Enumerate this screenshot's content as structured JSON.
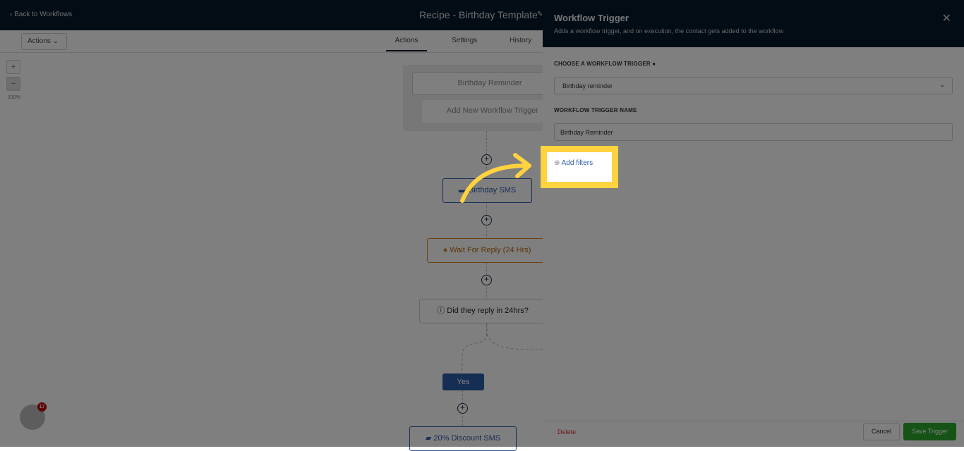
{
  "header": {
    "back_label": "Back to Workflows",
    "title": "Recipe - Birthday Template"
  },
  "toolbar": {
    "actions_label": "Actions",
    "tabs": [
      {
        "label": "Actions",
        "active": true
      },
      {
        "label": "Settings"
      },
      {
        "label": "History"
      }
    ]
  },
  "canvas": {
    "zoom_in": "+",
    "zoom_out": "−",
    "zoom_level": "100%",
    "trigger": "Birthday Reminder",
    "add_trigger": "Add New Workflow Trigger",
    "nodes": {
      "sms": "Birthday SMS",
      "wait": "Wait For Reply (24 Hrs)",
      "condition": "Did they reply in 24hrs?",
      "yes": "Yes",
      "discount": "20% Discount SMS"
    }
  },
  "panel": {
    "title": "Workflow Trigger",
    "subtitle": "Adds a workflow trigger, and on execution, the contact gets added to the workflow",
    "choose_label": "CHOOSE A WORKFLOW TRIGGER",
    "choose_value": "Birthday reminder",
    "name_label": "WORKFLOW TRIGGER NAME",
    "name_value": "Birthday Reminder",
    "add_filters": "Add filters",
    "delete": "Delete",
    "cancel": "Cancel",
    "save": "Save Trigger"
  },
  "chat": {
    "badge": "17"
  },
  "colors": {
    "header": "#03192b",
    "highlight": "#ffd23f",
    "save": "#2ba72e",
    "primary": "#2d5aa8",
    "wait": "#d9851f"
  }
}
